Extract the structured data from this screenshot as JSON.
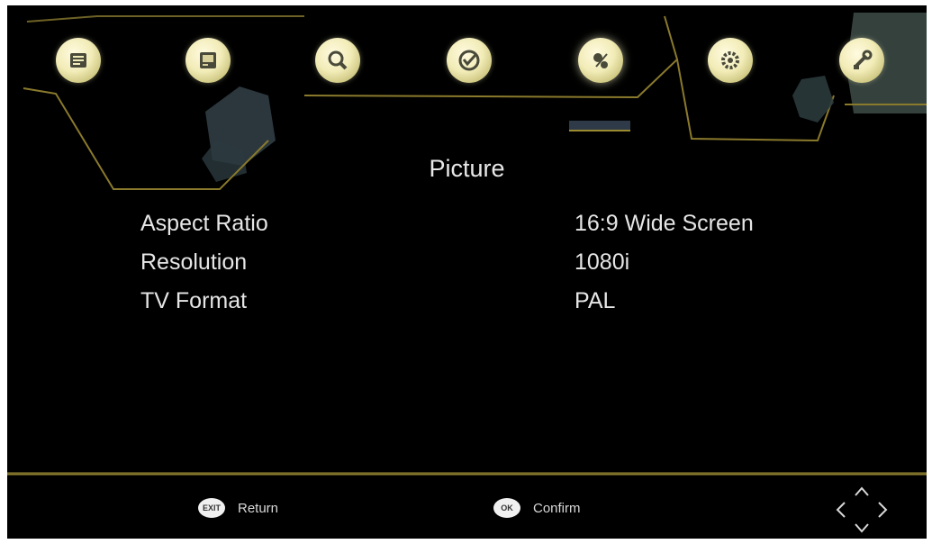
{
  "menu": {
    "icons": [
      {
        "name": "tv-list-icon",
        "active": false
      },
      {
        "name": "picture-icon",
        "active": false
      },
      {
        "name": "search-icon",
        "active": false
      },
      {
        "name": "clock-icon",
        "active": false
      },
      {
        "name": "options-icon",
        "active": true
      },
      {
        "name": "gear-icon",
        "active": false
      },
      {
        "name": "tools-icon",
        "active": false
      }
    ]
  },
  "page": {
    "title": "Picture"
  },
  "settings": [
    {
      "label": "Aspect Ratio",
      "value": "16:9 Wide Screen"
    },
    {
      "label": "Resolution",
      "value": "1080i"
    },
    {
      "label": "TV Format",
      "value": "PAL"
    }
  ],
  "footer": {
    "return_key": "EXIT",
    "return_label": "Return",
    "confirm_key": "OK",
    "confirm_label": "Confirm"
  },
  "colors": {
    "background": "#000000",
    "accent_gold": "#9a8a30",
    "text": "#e6e6e6",
    "icon_face": "#f2ecb8"
  }
}
